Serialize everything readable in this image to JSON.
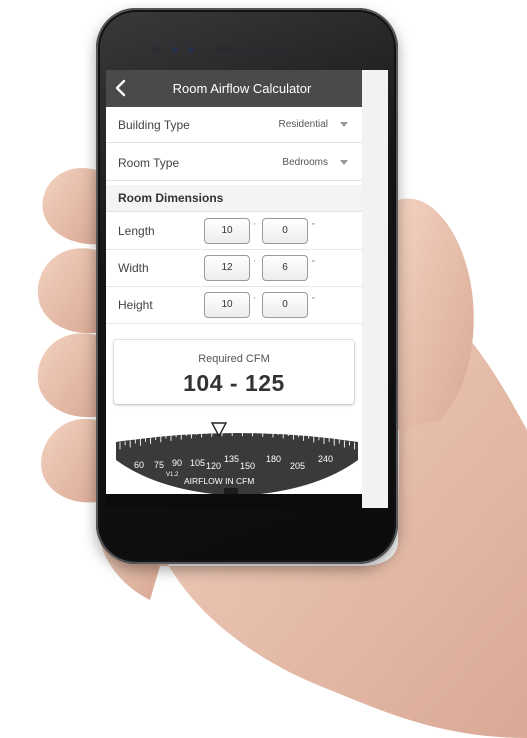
{
  "header": {
    "title": "Room Airflow Calculator",
    "back_icon": "chevron-left-icon"
  },
  "fields": {
    "building_type": {
      "label": "Building Type",
      "value": "Residential"
    },
    "room_type": {
      "label": "Room Type",
      "value": "Bedrooms"
    }
  },
  "dimensions": {
    "section_title": "Room Dimensions",
    "feet_mark": "'",
    "inch_mark": "\"",
    "rows": [
      {
        "label": "Length",
        "feet": "10",
        "inches": "0"
      },
      {
        "label": "Width",
        "feet": "12",
        "inches": "6"
      },
      {
        "label": "Height",
        "feet": "10",
        "inches": "0"
      }
    ]
  },
  "result": {
    "label": "Required CFM",
    "value": "104 - 125"
  },
  "dial": {
    "scale_labels": [
      "60",
      "75",
      "90",
      "105",
      "120",
      "135",
      "150",
      "180",
      "205",
      "240"
    ],
    "version": "V1.2",
    "caption": "AIRFLOW IN CFM",
    "pointer_value": 105
  },
  "colors": {
    "titlebar": "#4a4a4c",
    "dial": "#3a3a3c",
    "screen": "#ffffff"
  }
}
